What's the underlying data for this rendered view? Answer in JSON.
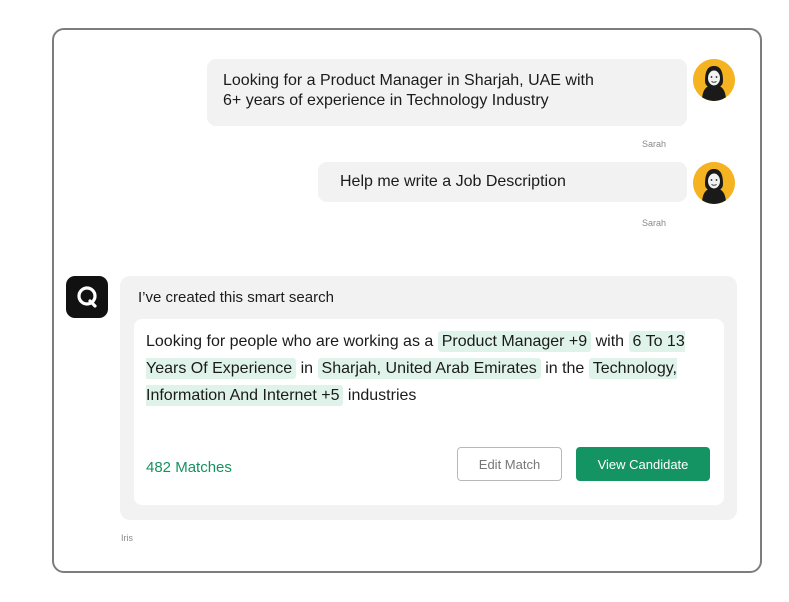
{
  "messages": [
    {
      "sender": "Sarah",
      "text_line1": "Looking for a Product Manager in Sharjah, UAE with",
      "text_line2": "6+ years of experience in Technology Industry",
      "avatar": "user-avatar-icon"
    },
    {
      "sender": "Sarah",
      "text": "Help me write a Job Description",
      "avatar": "user-avatar-icon"
    }
  ],
  "bot": {
    "sender": "Iris",
    "logo": "q-logo-icon",
    "title": "I’ve created this smart search",
    "query": {
      "text1": "Looking for people who are working as a",
      "chip1": "Product Manager +9",
      "text2": "with",
      "chip2": "6 To 13 Years Of Experience",
      "text3": "in",
      "chip3": "Sharjah, United Arab Emirates",
      "text4": "in the",
      "chip4": "Technology, Information And Internet +5",
      "text5": "industries"
    },
    "matches": "482 Matches",
    "edit_button": "Edit Match",
    "view_button": "View Candidate"
  },
  "colors": {
    "accent_green": "#149462",
    "chip_bg": "#dff3ea",
    "avatar_bg": "#f6b321",
    "bubble_bg": "#f2f2f2"
  }
}
